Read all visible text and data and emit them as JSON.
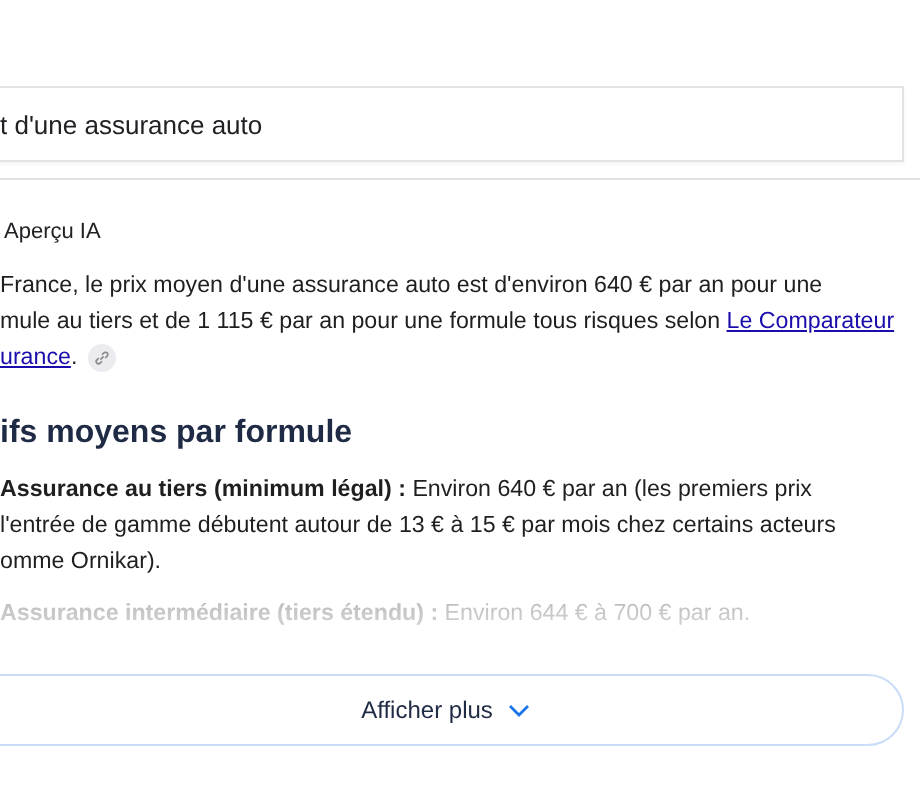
{
  "search": {
    "value": "t d'une assurance auto"
  },
  "overview": {
    "label": "Aperçu IA",
    "paragraph": [
      [
        {
          "kind": "text",
          "text": "France, le prix moyen d'une assurance auto est d'environ 640 € par an pour une"
        }
      ],
      [
        {
          "kind": "text",
          "text": "mule au tiers et de 1 115 € par an pour une formule tous risques selon "
        },
        {
          "kind": "link",
          "text": "Le Comparateur"
        }
      ],
      [
        {
          "kind": "link",
          "text": "urance"
        },
        {
          "kind": "text",
          "text": "."
        },
        {
          "kind": "chip"
        }
      ]
    ],
    "heading": "ifs moyens par formule",
    "items": [
      {
        "label": "Assurance au tiers (minimum légal) :",
        "lines": [
          "Environ 640 € par an (les premiers prix",
          "l'entrée de gamme débutent autour de 13 € à 15 € par mois chez certains acteurs",
          "omme Ornikar)."
        ],
        "faded": false
      },
      {
        "label": "Assurance intermédiaire (tiers étendu) :",
        "lines": [
          "Environ 644 € à 700 € par an."
        ],
        "faded": true
      }
    ],
    "more": "Afficher plus"
  }
}
